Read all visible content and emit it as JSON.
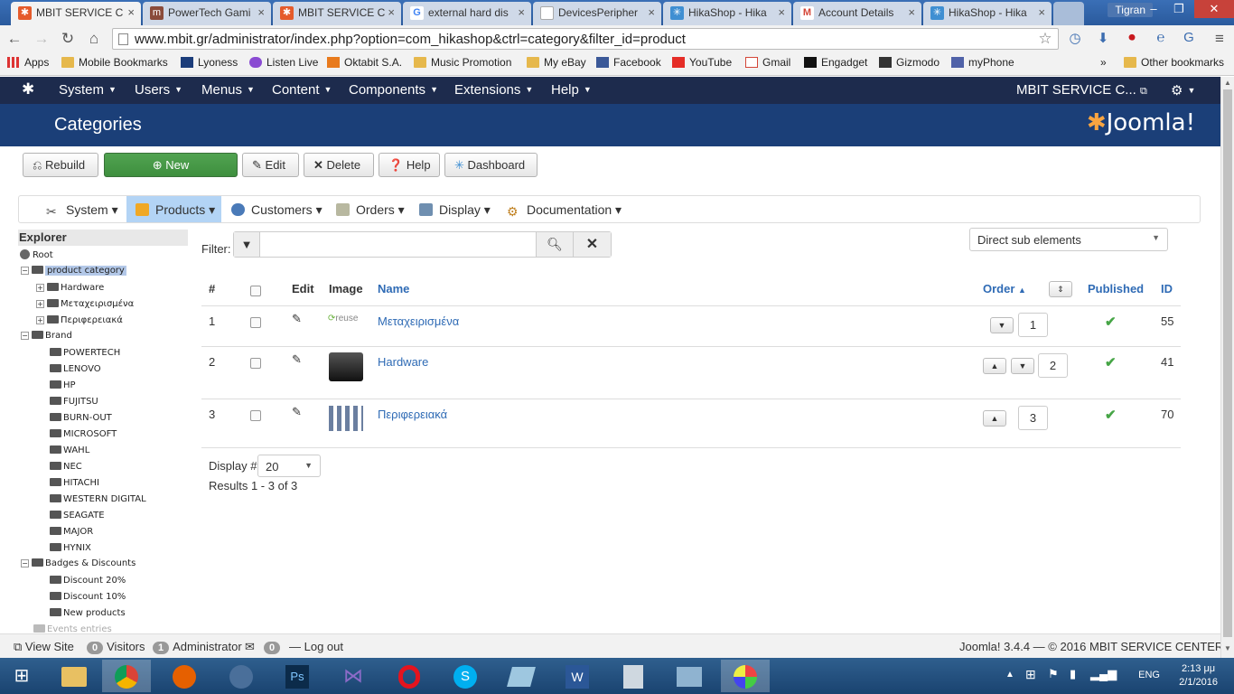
{
  "browser": {
    "tabs": [
      {
        "title": "MBIT SERVICE C",
        "icon": "joomla-icon",
        "color": "#e55b2b",
        "active": true
      },
      {
        "title": "PowerTech Gami",
        "icon": "page-icon",
        "color": "#8a4b3a"
      },
      {
        "title": "MBIT SERVICE C",
        "icon": "joomla-icon",
        "color": "#e55b2b"
      },
      {
        "title": "external hard dis",
        "icon": "google-icon",
        "color": "#4285f4"
      },
      {
        "title": "DevicesPeripher",
        "icon": "doc-icon",
        "color": "#aaaaaa"
      },
      {
        "title": "HikaShop - Hika",
        "icon": "hikashop-icon",
        "color": "#3f8fd2"
      },
      {
        "title": "Account Details",
        "icon": "gmail-icon",
        "color": "#d44638"
      },
      {
        "title": "HikaShop - Hika",
        "icon": "hikashop-icon",
        "color": "#3f8fd2"
      }
    ],
    "user": "Tigran",
    "url": "www.mbit.gr/administrator/index.php?option=com_hikashop&ctrl=category&filter_id=product",
    "bookmarks": [
      "Apps",
      "Mobile Bookmarks",
      "Lyoness",
      "Listen Live",
      "Oktabit S.A.",
      "Music Promotion",
      "My eBay",
      "Facebook",
      "YouTube",
      "Gmail",
      "Engadget",
      "Gizmodo",
      "myPhone"
    ],
    "bookmarks_more": "»",
    "other_bookmarks": "Other bookmarks"
  },
  "joomla": {
    "menu": [
      "System",
      "Users",
      "Menus",
      "Content",
      "Components",
      "Extensions",
      "Help"
    ],
    "site_name": "MBIT SERVICE C...",
    "page_title": "Categories",
    "logo_text": "Joomla!"
  },
  "toolbar": {
    "rebuild": "Rebuild",
    "new": "New",
    "edit": "Edit",
    "delete": "Delete",
    "help": "Help",
    "dashboard": "Dashboard"
  },
  "hikamenu": [
    "System",
    "Products",
    "Customers",
    "Orders",
    "Display",
    "Documentation"
  ],
  "explorer": {
    "title": "Explorer",
    "root": "Root",
    "product_category": "product category",
    "products": [
      "Hardware",
      "Μεταχειρισμένα",
      "Περιφερειακά"
    ],
    "brand": "Brand",
    "brands": [
      "POWERTECH",
      "LENOVO",
      "HP",
      "FUJITSU",
      "BURN-OUT",
      "MICROSOFT",
      "WAHL",
      "NEC",
      "HITACHI",
      "WESTERN DIGITAL",
      "SEAGATE",
      "MAJOR",
      "HYNIX"
    ],
    "badges": "Badges & Discounts",
    "badge_items": [
      "Discount 20%",
      "Discount 10%",
      "New products"
    ],
    "events": "Events entries"
  },
  "filter": {
    "label": "Filter:",
    "value": "",
    "scope": "Direct sub elements"
  },
  "table": {
    "headers": {
      "num": "#",
      "edit": "Edit",
      "image": "Image",
      "name": "Name",
      "order": "Order",
      "published": "Published",
      "id": "ID"
    },
    "rows": [
      {
        "num": "1",
        "name": "Μεταχειρισμένα",
        "image": "reuse",
        "order": "1",
        "id": "55"
      },
      {
        "num": "2",
        "name": "Hardware",
        "image": "hardware-image",
        "order": "2",
        "id": "41"
      },
      {
        "num": "3",
        "name": "Περιφερειακά",
        "image": "peripherals-image",
        "order": "3",
        "id": "70"
      }
    ]
  },
  "pagination": {
    "display_label": "Display #",
    "display_value": "20",
    "results": "Results 1 - 3 of 3"
  },
  "status": {
    "view_site": "View Site",
    "visitors_count": "0",
    "visitors": "Visitors",
    "admin_count": "1",
    "administrator": "Administrator",
    "messages_count": "0",
    "logout": "Log out",
    "footer": "Joomla! 3.4.4  —  © 2016 MBIT SERVICE CENTER"
  },
  "taskbar": {
    "lang": "ENG",
    "time": "2:13 μμ",
    "date": "2/1/2016"
  }
}
